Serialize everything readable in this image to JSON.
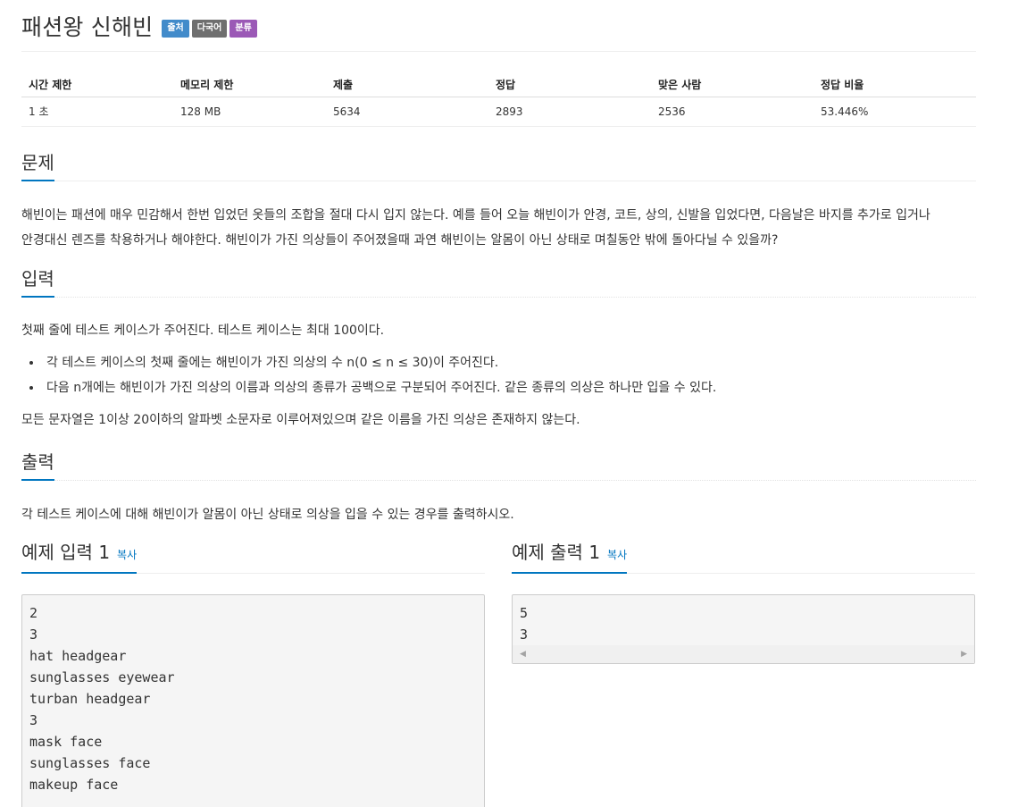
{
  "problem": {
    "title": "패션왕 신해빈",
    "labels": [
      {
        "text": "출처",
        "color": "#428bca"
      },
      {
        "text": "다국어",
        "color": "#6f6f6f"
      },
      {
        "text": "분류",
        "color": "#9b59b6"
      }
    ]
  },
  "info_table": {
    "headers": [
      "시간 제한",
      "메모리 제한",
      "제출",
      "정답",
      "맞은 사람",
      "정답 비율"
    ],
    "values": [
      "1 초",
      "128 MB",
      "5634",
      "2893",
      "2536",
      "53.446%"
    ]
  },
  "sections": {
    "problem": {
      "heading": "문제",
      "lines": [
        "해빈이는 패션에 매우 민감해서 한번 입었던 옷들의 조합을 절대 다시 입지 않는다. 예를 들어 오늘 해빈이가 안경, 코트, 상의, 신발을 입었다면, 다음날은 바지를 추가로 입거나",
        "안경대신 렌즈를 착용하거나 해야한다. 해빈이가 가진 의상들이 주어졌을때 과연 해빈이는 알몸이 아닌 상태로 며칠동안 밖에 돌아다닐 수 있을까?"
      ]
    },
    "input": {
      "heading": "입력",
      "intro": "첫째 줄에 테스트 케이스가 주어진다. 테스트 케이스는 최대 100이다.",
      "bullets": [
        "각 테스트 케이스의 첫째 줄에는 해빈이가 가진 의상의 수 n(0 ≤ n ≤ 30)이 주어진다.",
        "다음 n개에는 해빈이가 가진 의상의 이름과 의상의 종류가 공백으로 구분되어 주어진다. 같은 종류의 의상은 하나만 입을 수 있다."
      ],
      "outro": "모든 문자열은 1이상 20이하의 알파벳 소문자로 이루어져있으며 같은 이름을 가진 의상은 존재하지 않는다."
    },
    "output": {
      "heading": "출력",
      "text": "각 테스트 케이스에 대해 해빈이가 알몸이 아닌 상태로 의상을 입을 수 있는 경우를 출력하시오."
    }
  },
  "samples": {
    "input": {
      "title": "예제 입력 1",
      "copy_label": "복사",
      "content": "2\n3\nhat headgear\nsunglasses eyewear\nturban headgear\n3\nmask face\nsunglasses face\nmakeup face"
    },
    "output": {
      "title": "예제 출력 1",
      "copy_label": "복사",
      "content": "5\n3",
      "scroll_left_icon": "◀",
      "scroll_right_icon": "▶"
    }
  }
}
